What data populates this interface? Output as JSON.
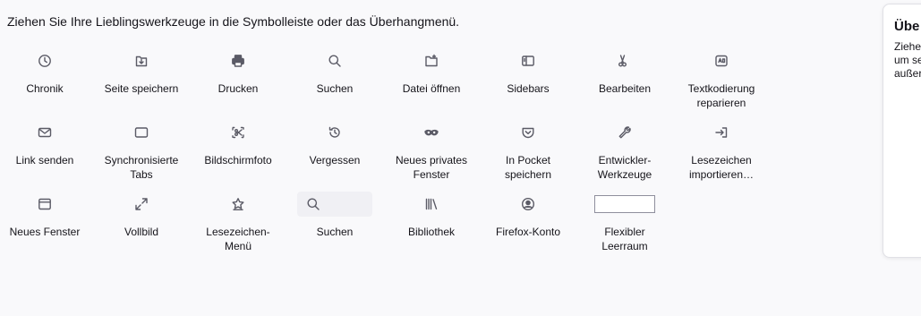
{
  "heading": "Ziehen Sie Ihre Lieblingswerkzeuge in die Symbolleiste oder das Überhangmenü.",
  "rows": [
    [
      {
        "label": "Chronik",
        "icon": "clock-icon"
      },
      {
        "label": "Seite speichern",
        "icon": "save-page-icon"
      },
      {
        "label": "Drucken",
        "icon": "printer-icon"
      },
      {
        "label": "Suchen",
        "icon": "search-icon"
      },
      {
        "label": "Datei öffnen",
        "icon": "open-file-icon"
      },
      {
        "label": "Sidebars",
        "icon": "sidebar-icon"
      },
      {
        "label": "Bearbeiten",
        "icon": "edit-controls-icon"
      },
      {
        "label": "Textkodierung reparieren",
        "icon": "text-encoding-icon"
      }
    ],
    [
      {
        "label": "Link senden",
        "icon": "mail-icon"
      },
      {
        "label": "Synchronisierte Tabs",
        "icon": "synced-tabs-icon"
      },
      {
        "label": "Bildschirmfoto",
        "icon": "screenshot-icon"
      },
      {
        "label": "Vergessen",
        "icon": "history-forget-icon"
      },
      {
        "label": "Neues privates Fenster",
        "icon": "private-mask-icon"
      },
      {
        "label": "In Pocket speichern",
        "icon": "pocket-icon"
      },
      {
        "label": "Entwickler-Werkzeuge",
        "icon": "wrench-icon"
      },
      {
        "label": "Lesezeichen importieren…",
        "icon": "import-icon"
      }
    ],
    [
      {
        "label": "Neues Fenster",
        "icon": "window-icon"
      },
      {
        "label": "Vollbild",
        "icon": "fullscreen-icon"
      },
      {
        "label": "Lesezeichen-Menü",
        "icon": "bookmark-star-icon"
      },
      {
        "label": "Suchen",
        "icon": "search-box-icon"
      },
      {
        "label": "Bibliothek",
        "icon": "library-icon"
      },
      {
        "label": "Firefox-Konto",
        "icon": "account-icon"
      },
      {
        "label": "Flexibler Leerraum",
        "icon": "flexible-space-icon"
      }
    ]
  ],
  "side_panel": {
    "title": "Übe",
    "lines": [
      "Ziehe",
      "um se",
      "außer"
    ]
  }
}
